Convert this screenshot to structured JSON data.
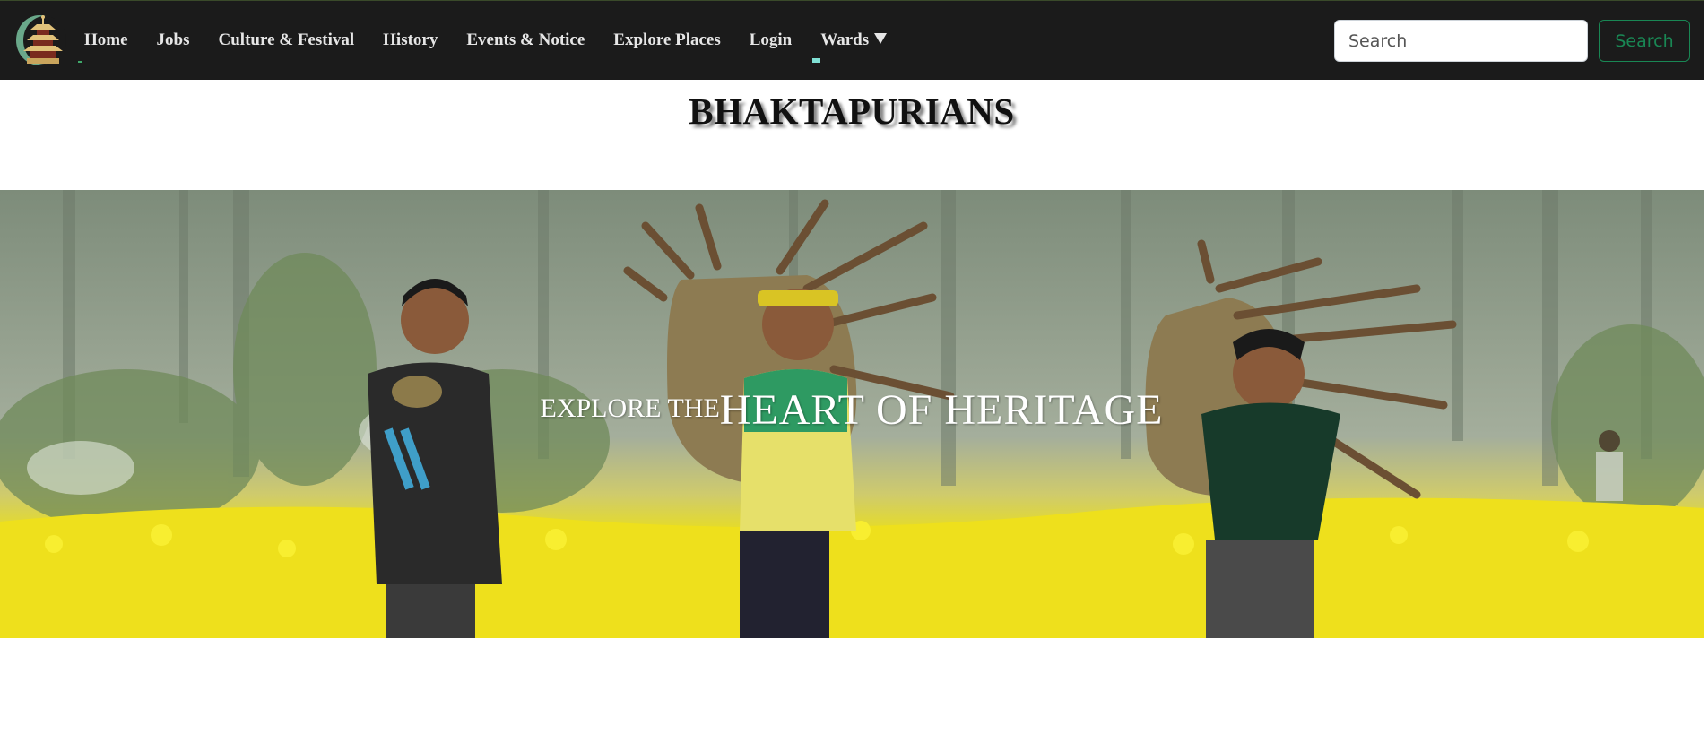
{
  "navbar": {
    "logo_icon": "pagoda-temple-logo-icon",
    "links": [
      {
        "label": "Home"
      },
      {
        "label": "Jobs"
      },
      {
        "label": "Culture & Festival"
      },
      {
        "label": "History"
      },
      {
        "label": "Events & Notice"
      },
      {
        "label": "Explore Places"
      },
      {
        "label": "Login"
      },
      {
        "label": "Wards"
      }
    ],
    "wards_icon": "caret-down-icon",
    "search": {
      "placeholder": "Search",
      "button_label": "Search"
    },
    "colors": {
      "background": "#1b1b1b",
      "link": "#e6e6e6",
      "search_button": "#198754"
    }
  },
  "brand": {
    "title": "BHAKTAPURIANS"
  },
  "hero": {
    "image": "children-carrying-firewood-baskets-in-mustard-field",
    "tagline_small": "EXPLORE THE",
    "tagline_big": "HEART OF HERITAGE"
  }
}
